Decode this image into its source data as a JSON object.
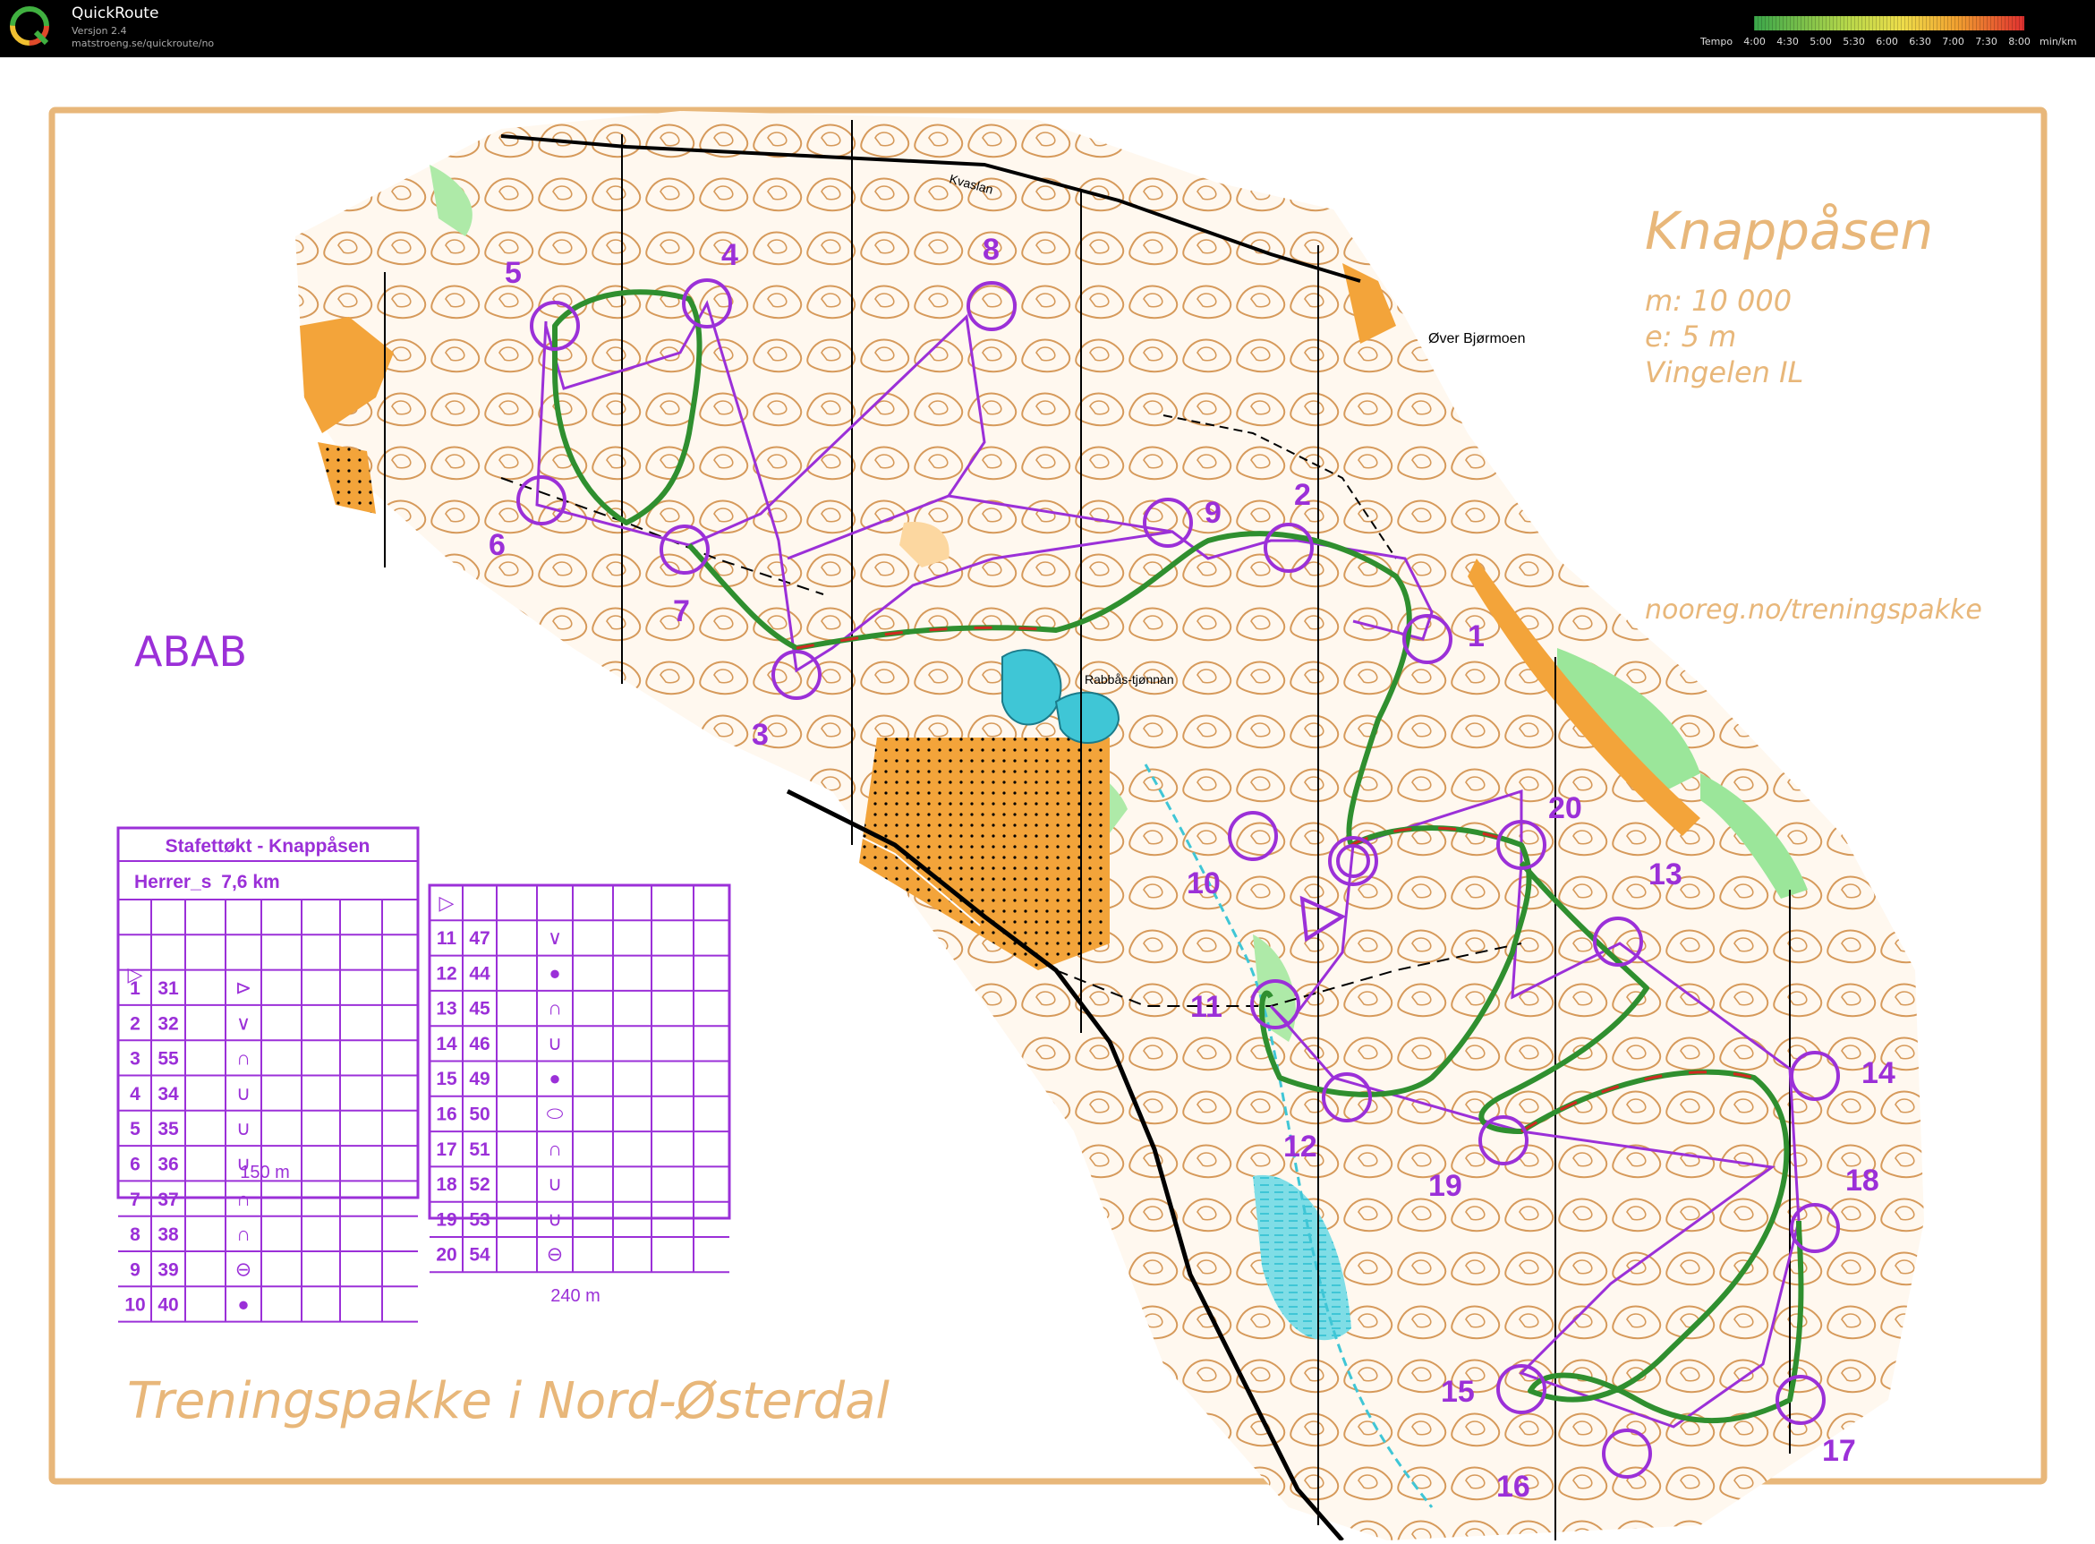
{
  "app": {
    "name": "QuickRoute",
    "version": "Versjon 2.4",
    "url": "matstroeng.se/quickroute/no"
  },
  "pace_scale": {
    "label": "Tempo",
    "ticks": [
      "4:00",
      "4:30",
      "5:00",
      "5:30",
      "6:00",
      "6:30",
      "7:00",
      "7:30",
      "8:00"
    ],
    "unit": "min/km",
    "colors": [
      "#3aa64a",
      "#6cbf4a",
      "#a8d24a",
      "#dede4a",
      "#f0c040",
      "#f0a030",
      "#ee7a30",
      "#e85030",
      "#e03030"
    ]
  },
  "map": {
    "title": "Knappåsen",
    "scale": "m:  10 000",
    "equidistance": "e: 5 m",
    "club": "Vingelen IL",
    "website": "nooreg.no/treningspakke",
    "variant": "ABAB",
    "footer": "Treningspakke i Nord-Østerdal",
    "place_over_bjormoen": "Øver Bjørmoen",
    "place_lake": "Rabbås-tjønnan",
    "place_road": "Kvaslan",
    "colors": {
      "frame": "#e8b77a",
      "course": "#9b30d8",
      "contour": "#c87a2a",
      "open": "#f3a43a",
      "water": "#3fc6d6",
      "green": "#7fe07a",
      "route_fast": "#2f8f2f",
      "route_slow": "#d02a20"
    }
  },
  "controls": [
    {
      "n": "1",
      "label": "1"
    },
    {
      "n": "2",
      "label": "2"
    },
    {
      "n": "3",
      "label": "3"
    },
    {
      "n": "4",
      "label": "4"
    },
    {
      "n": "5",
      "label": "5"
    },
    {
      "n": "6",
      "label": "6"
    },
    {
      "n": "7",
      "label": "7"
    },
    {
      "n": "8",
      "label": "8"
    },
    {
      "n": "9",
      "label": "9"
    },
    {
      "n": "10",
      "label": "10"
    },
    {
      "n": "11",
      "label": "11"
    },
    {
      "n": "12",
      "label": "12"
    },
    {
      "n": "13",
      "label": "13"
    },
    {
      "n": "14",
      "label": "14"
    },
    {
      "n": "15",
      "label": "15"
    },
    {
      "n": "16",
      "label": "16"
    },
    {
      "n": "17",
      "label": "17"
    },
    {
      "n": "18",
      "label": "18"
    },
    {
      "n": "19",
      "label": "19"
    },
    {
      "n": "20",
      "label": "20"
    }
  ],
  "description_left": {
    "title": "Stafettøkt - Knappåsen",
    "class": "Herrer_s",
    "length": "7,6 km",
    "rows": [
      {
        "num": "1",
        "code": "31",
        "sym": "⊳"
      },
      {
        "num": "2",
        "code": "32",
        "sym": "∨"
      },
      {
        "num": "3",
        "code": "55",
        "sym": "∩"
      },
      {
        "num": "4",
        "code": "34",
        "sym": "∪"
      },
      {
        "num": "5",
        "code": "35",
        "sym": "∪"
      },
      {
        "num": "6",
        "code": "36",
        "sym": "∪"
      },
      {
        "num": "7",
        "code": "37",
        "sym": "∩"
      },
      {
        "num": "8",
        "code": "38",
        "sym": "∩"
      },
      {
        "num": "9",
        "code": "39",
        "sym": "⊖"
      },
      {
        "num": "10",
        "code": "40",
        "sym": "●"
      }
    ],
    "finish": "150 m"
  },
  "description_right": {
    "rows": [
      {
        "num": "11",
        "code": "47",
        "sym": "∨"
      },
      {
        "num": "12",
        "code": "44",
        "sym": "●"
      },
      {
        "num": "13",
        "code": "45",
        "sym": "∩"
      },
      {
        "num": "14",
        "code": "46",
        "sym": "∪"
      },
      {
        "num": "15",
        "code": "49",
        "sym": "●"
      },
      {
        "num": "16",
        "code": "50",
        "sym": "⬭"
      },
      {
        "num": "17",
        "code": "51",
        "sym": "∩"
      },
      {
        "num": "18",
        "code": "52",
        "sym": "∪"
      },
      {
        "num": "19",
        "code": "53",
        "sym": "∪"
      },
      {
        "num": "20",
        "code": "54",
        "sym": "⊖"
      }
    ],
    "finish": "240 m"
  }
}
